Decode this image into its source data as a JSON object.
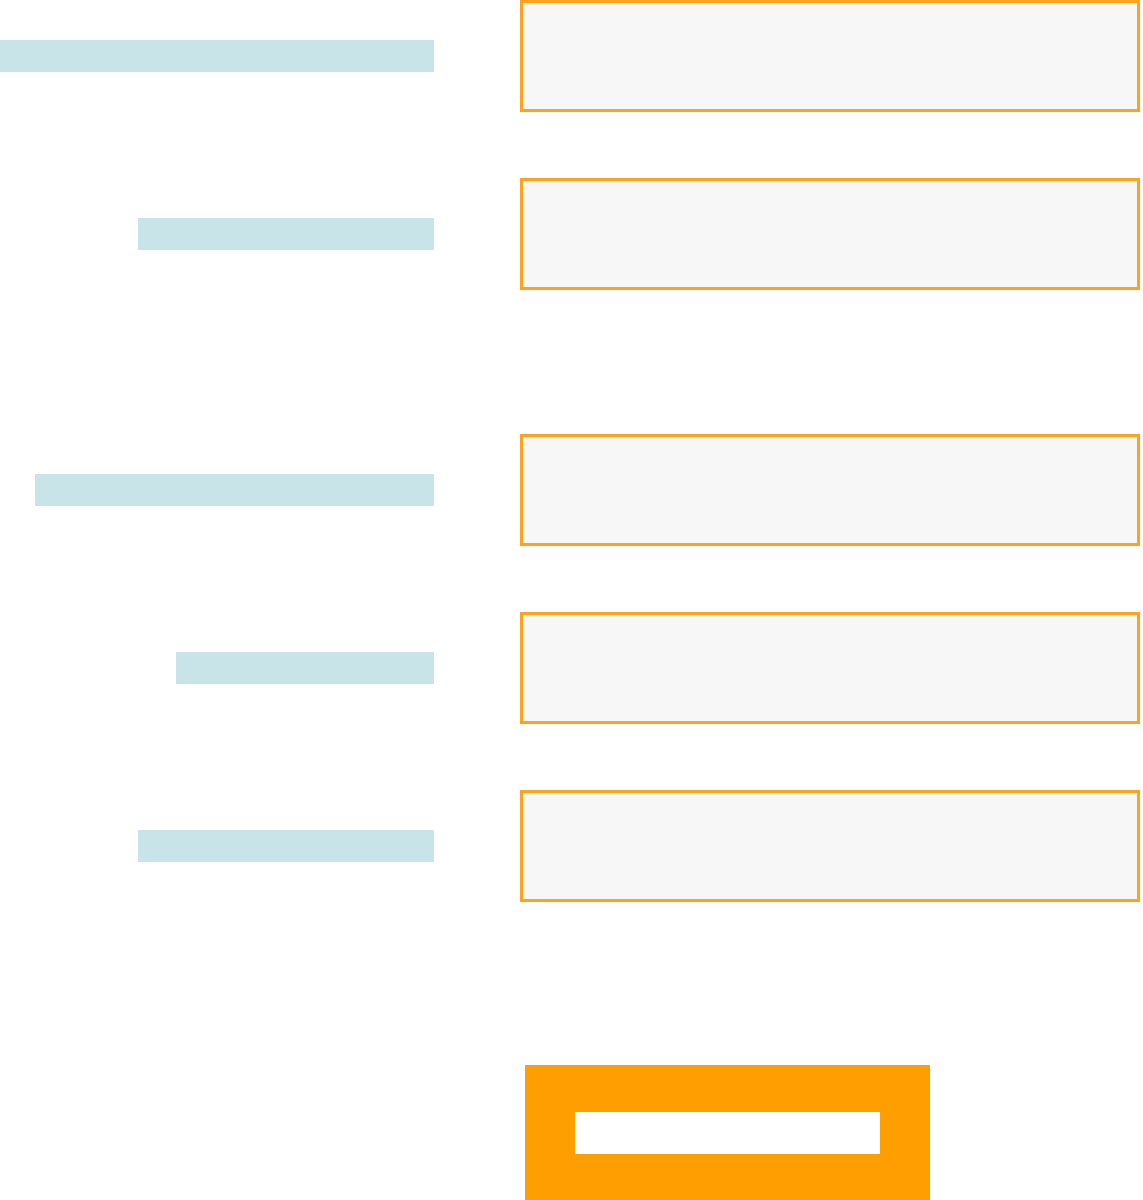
{
  "form": {
    "sections": [
      {
        "fields": [
          {
            "kind": "text"
          },
          {
            "kind": "text"
          }
        ]
      },
      {
        "fields": [
          {
            "kind": "text"
          },
          {
            "kind": "text"
          },
          {
            "kind": "text"
          }
        ]
      }
    ],
    "submit": {
      "kind": "primary"
    }
  }
}
